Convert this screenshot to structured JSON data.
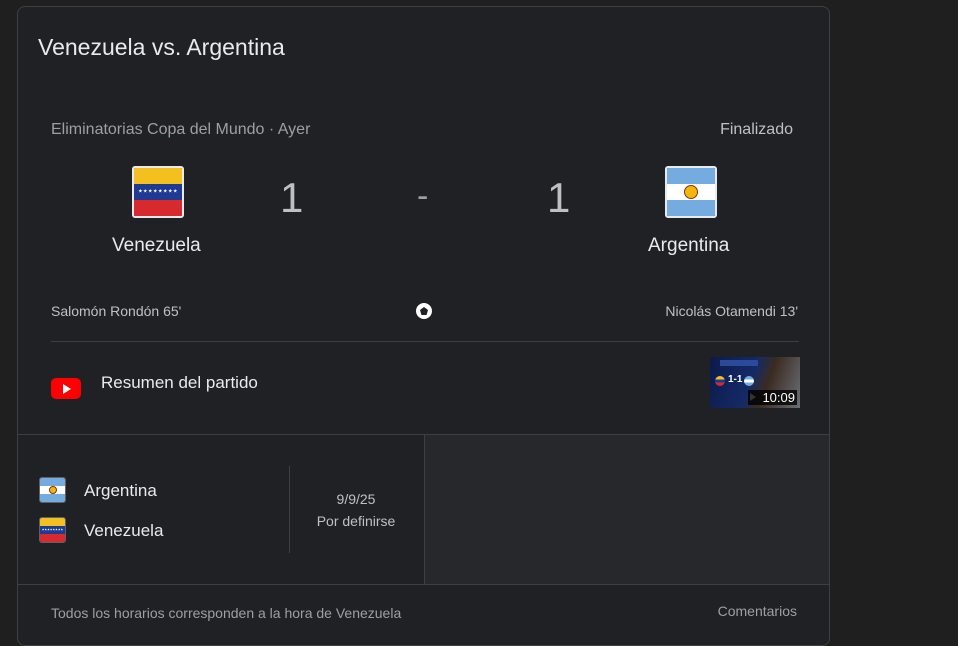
{
  "card": {
    "title": "Venezuela vs. Argentina",
    "competition": "Eliminatorias Copa del Mundo · Ayer",
    "status": "Finalizado"
  },
  "match": {
    "home": {
      "name": "Venezuela",
      "score": "1",
      "scorer": "Salomón Rondón 65'",
      "flag": "venezuela-flag"
    },
    "away": {
      "name": "Argentina",
      "score": "1",
      "scorer": "Nicolás Otamendi 13'",
      "flag": "argentina-flag"
    },
    "separator": "-"
  },
  "highlights": {
    "label": "Resumen del partido",
    "duration": "10:09",
    "thumbnail_score": "1-1"
  },
  "next_match": {
    "teams": [
      "Argentina",
      "Venezuela"
    ],
    "date": "9/9/25",
    "status": "Por definirse"
  },
  "footer": {
    "note": "Todos los horarios corresponden a la hora de Venezuela",
    "feedback": "Comentarios"
  },
  "colors": {
    "background": "#1f1f1f",
    "card": "#202124",
    "text": "#e8eaed",
    "muted": "#9aa0a6",
    "youtube": "#ff0000"
  }
}
